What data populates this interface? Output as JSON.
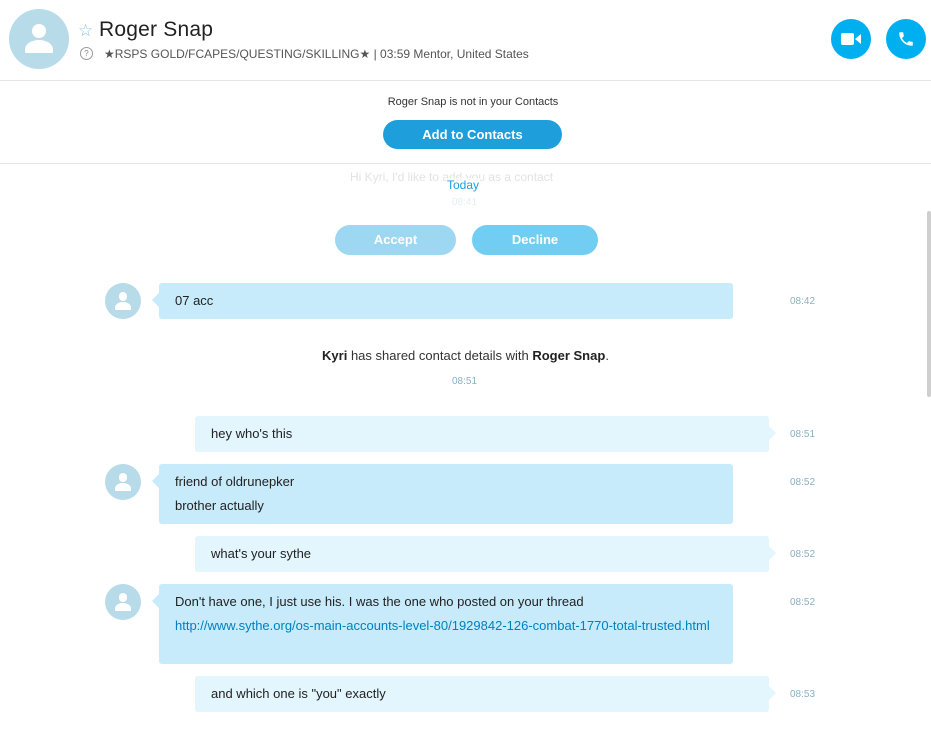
{
  "header": {
    "name": "Roger Snap",
    "mood": "★RSPS GOLD/FCAPES/QUESTING/SKILLING★  |  03:59 Mentor, United States",
    "star_icon": "star-outline-icon",
    "help_icon": "question-circle-icon",
    "video_call_icon": "video-camera-icon",
    "audio_call_icon": "phone-icon",
    "accent_color": "#00aff0"
  },
  "request": {
    "not_in_contacts": "Roger Snap is not in your Contacts",
    "add_button": "Add to Contacts",
    "ghost_text": "Hi Kyri, I'd like to add you as a contact",
    "ghost_time": "08:41",
    "date_label": "Today",
    "accept_label": "Accept",
    "decline_label": "Decline"
  },
  "messages": [
    {
      "direction": "in",
      "lines": [
        "07 acc"
      ],
      "time": "08:42"
    },
    {
      "direction": "system",
      "sender": "Kyri",
      "text": " has shared contact details with ",
      "target": "Roger Snap",
      "end": ".",
      "time": "08:51"
    },
    {
      "direction": "out",
      "lines": [
        "hey who's this"
      ],
      "time": "08:51"
    },
    {
      "direction": "in",
      "lines": [
        "friend of oldrunepker",
        "brother actually"
      ],
      "time": "08:52"
    },
    {
      "direction": "out",
      "lines": [
        "what's your sythe"
      ],
      "time": "08:52"
    },
    {
      "direction": "in",
      "lines": [
        "Don't have one, I just use his. I was the one who posted on your thread"
      ],
      "link": "http://www.sythe.org/os-main-accounts-level-80/1929842-126-combat-1770-total-trusted.html",
      "time": "08:52"
    },
    {
      "direction": "out",
      "lines": [
        "and which one is \"you\" exactly"
      ],
      "time": "08:53"
    }
  ]
}
